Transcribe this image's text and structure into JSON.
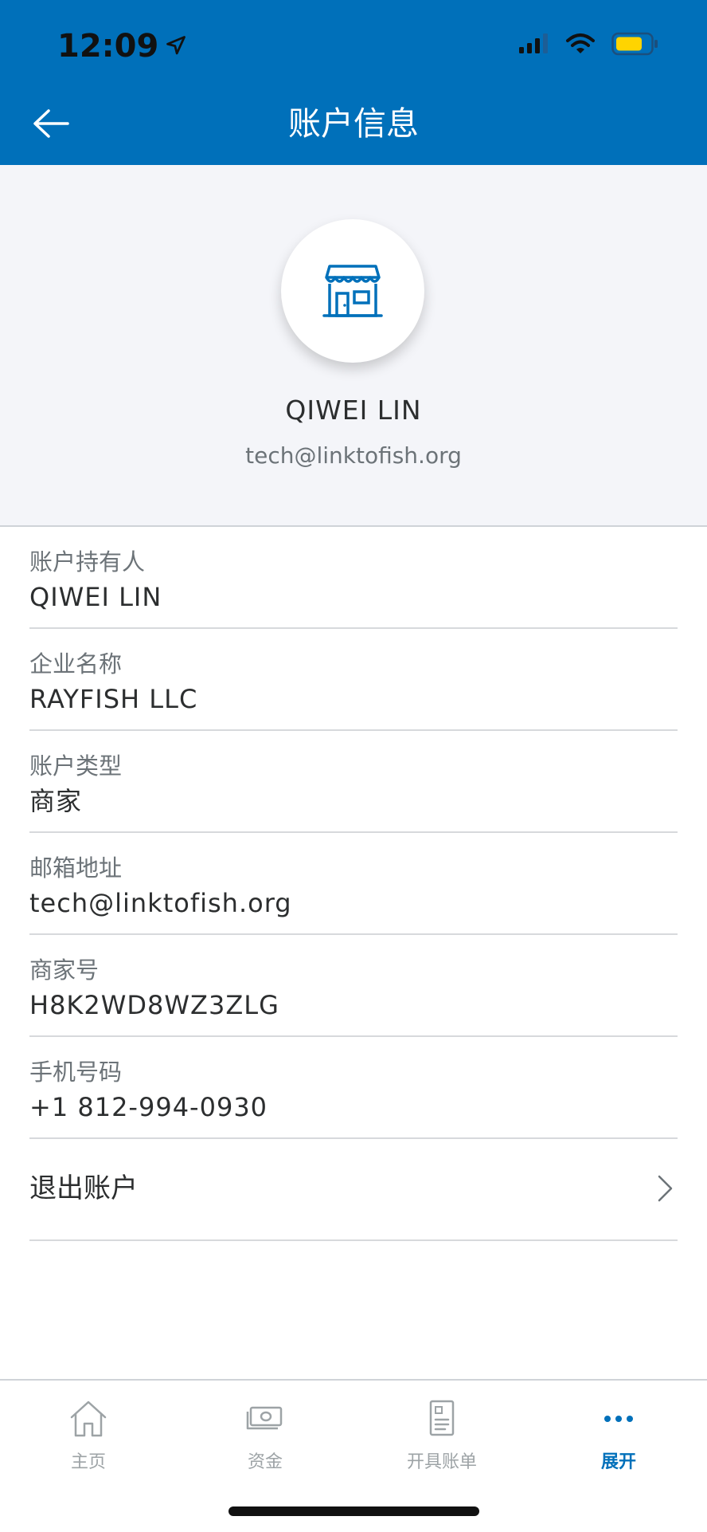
{
  "status_bar": {
    "time": "12:09",
    "battery_color": "#ffd400"
  },
  "header": {
    "title": "账户信息",
    "background": "#0070ba"
  },
  "profile": {
    "name": "QIWEI LIN",
    "email": "tech@linktofish.org",
    "avatar_icon": "store-icon"
  },
  "info": {
    "rows": [
      {
        "label": "账户持有人",
        "value": "QIWEI LIN"
      },
      {
        "label": "企业名称",
        "value": "RAYFISH LLC"
      },
      {
        "label": "账户类型",
        "value": "商家"
      },
      {
        "label": "邮箱地址",
        "value": "tech@linktofish.org"
      },
      {
        "label": "商家号",
        "value": "H8K2WD8WZ3ZLG"
      },
      {
        "label": "手机号码",
        "value": "+1 812-994-0930"
      }
    ],
    "logout_label": "退出账户"
  },
  "tabbar": {
    "tabs": [
      {
        "label": "主页",
        "icon": "home-icon"
      },
      {
        "label": "资金",
        "icon": "money-icon"
      },
      {
        "label": "开具账单",
        "icon": "invoice-icon"
      },
      {
        "label": "展开",
        "icon": "more-icon",
        "active": true
      }
    ],
    "active_color": "#0070ba",
    "inactive_color": "#9da3a6"
  }
}
